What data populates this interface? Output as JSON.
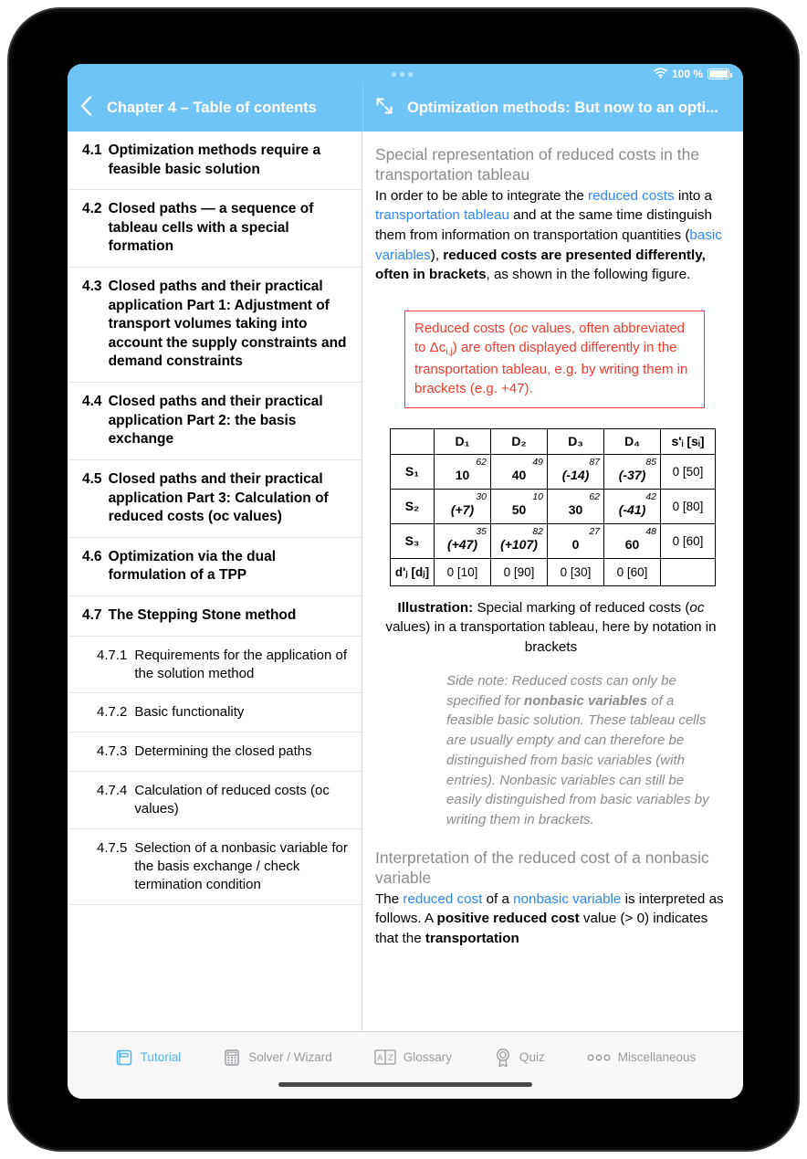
{
  "status_bar": {
    "wifi_icon": "wifi-icon",
    "battery_percent": "100 %",
    "battery_icon": "battery-full-icon",
    "multitask_icon": "multitask-dots-icon"
  },
  "nav": {
    "back_icon": "chevron-left-icon",
    "left_title": "Chapter 4 – Table of contents",
    "expand_icon": "expand-arrows-icon",
    "right_title": "Optimization methods: But now to an opti..."
  },
  "toc": {
    "items": [
      {
        "num": "4.1",
        "label": "Optimization methods require a feasible basic solution",
        "sub": false
      },
      {
        "num": "4.2",
        "label": "Closed paths — a sequence of tableau cells with a special formation",
        "sub": false
      },
      {
        "num": "4.3",
        "label": "Closed paths and their practical application Part 1: Adjustment of transport volumes taking into account the supply constraints and demand constraints",
        "sub": false
      },
      {
        "num": "4.4",
        "label": "Closed paths and their practical application Part 2: the basis exchange",
        "sub": false
      },
      {
        "num": "4.5",
        "label": "Closed paths and their practical application Part 3: Calculation of reduced costs (oc values)",
        "sub": false
      },
      {
        "num": "4.6",
        "label": "Optimization via the dual formulation of a TPP",
        "sub": false
      },
      {
        "num": "4.7",
        "label": "The Stepping Stone method",
        "sub": false
      },
      {
        "num": "4.7.1",
        "label": "Requirements for the application of the solution method",
        "sub": true
      },
      {
        "num": "4.7.2",
        "label": "Basic functionality",
        "sub": true
      },
      {
        "num": "4.7.3",
        "label": "Determining the closed paths",
        "sub": true
      },
      {
        "num": "4.7.4",
        "label": "Calculation of reduced costs (oc values)",
        "sub": true
      },
      {
        "num": "4.7.5",
        "label": "Selection of a nonbasic variable for the basis exchange / check termination condition",
        "sub": true
      }
    ]
  },
  "content": {
    "heading_1": "Special representation of reduced costs in the transportation tableau",
    "para_1": {
      "t1": "In order to be able to integrate the ",
      "l1": "reduced costs",
      "t2": " into a ",
      "l2": "transportation tableau",
      "t3": " and at the same time distinguish them from information on transportation quantities (",
      "l3": "basic variables",
      "t4": "), ",
      "b1": "reduced costs are presented differently, often in brackets",
      "t5": ", as shown in the following figure."
    },
    "red_note": {
      "t1": "Reduced costs (",
      "i1": "oc",
      "t2": " values, often abbreviated to Δc",
      "sub1": "i,j",
      "t3": ") are often displayed differently in the transportation tableau, e.g. by writing them in brackets (e.g. +47)."
    },
    "caption": {
      "b1": "Illustration:",
      "t1": " Special marking of reduced costs (",
      "i1": "oc",
      "t2": " values) in a transportation tableau, here by notation in brackets"
    },
    "side_note": {
      "t1": "Side note: Reduced costs can only be specified for ",
      "b1": "nonbasic variables",
      "t2": " of a feasible basic solution. These tableau cells are usually empty and can therefore be distinguished from basic variables (with entries). Nonbasic variables can still be easily distinguished from basic variables by writing them in brackets."
    },
    "heading_2": "Interpretation of the reduced cost of a nonbasic variable",
    "para_2": {
      "t1": "The ",
      "l1": "reduced cost",
      "t2": " of a ",
      "l2": "nonbasic variable",
      "t3": " is interpreted as follows. A ",
      "b1": "positive reduced cost",
      "t4": " value (> 0) indicates that the ",
      "b2": "transportation"
    }
  },
  "chart_data": {
    "type": "table",
    "title": "Transportation tableau with reduced costs in brackets",
    "corner_label": "",
    "columns": [
      "D₁",
      "D₂",
      "D₃",
      "D₄",
      "s'ᵢ [sᵢ]"
    ],
    "row_labels": [
      "S₁",
      "S₂",
      "S₃"
    ],
    "footer_label": "d'ⱼ [dⱼ]",
    "footer_values": [
      "0 [10]",
      "0 [90]",
      "0 [30]",
      "0 [60]"
    ],
    "supply_values": [
      "0 [50]",
      "0 [80]",
      "0 [60]"
    ],
    "cells": [
      [
        {
          "cost": "62",
          "value": "10",
          "nonbasic": false
        },
        {
          "cost": "49",
          "value": "40",
          "nonbasic": false
        },
        {
          "cost": "87",
          "value": "(-14)",
          "nonbasic": true
        },
        {
          "cost": "85",
          "value": "(-37)",
          "nonbasic": true
        }
      ],
      [
        {
          "cost": "30",
          "value": "(+7)",
          "nonbasic": true
        },
        {
          "cost": "10",
          "value": "50",
          "nonbasic": false
        },
        {
          "cost": "62",
          "value": "30",
          "nonbasic": false
        },
        {
          "cost": "42",
          "value": "(-41)",
          "nonbasic": true
        }
      ],
      [
        {
          "cost": "35",
          "value": "(+47)",
          "nonbasic": true
        },
        {
          "cost": "82",
          "value": "(+107)",
          "nonbasic": true
        },
        {
          "cost": "27",
          "value": "0",
          "nonbasic": false
        },
        {
          "cost": "48",
          "value": "60",
          "nonbasic": false
        }
      ]
    ]
  },
  "tabs": [
    {
      "label": "Tutorial",
      "icon": "book-icon",
      "active": true
    },
    {
      "label": "Solver / Wizard",
      "icon": "calculator-icon",
      "active": false
    },
    {
      "label": "Glossary",
      "icon": "az-icon",
      "active": false
    },
    {
      "label": "Quiz",
      "icon": "award-rosette-icon",
      "active": false
    },
    {
      "label": "Miscellaneous",
      "icon": "three-circles-icon",
      "active": false
    }
  ],
  "colors": {
    "accent_blue": "#6FC4F7",
    "link_blue": "#2f86f0",
    "alert_red": "#ef3b2d",
    "muted_gray": "#8b8b90"
  }
}
